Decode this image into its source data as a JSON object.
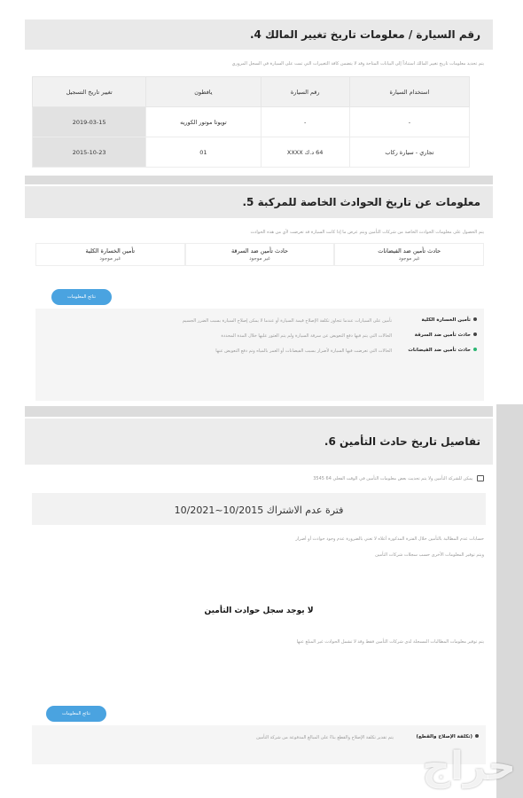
{
  "sections": {
    "s4": {
      "title": "رقم السيارة / معلومات تاريخ تغيير المالك 4.",
      "intro": "يتم تحديد معلومات تاريخ تغيير المالك استناداً إلى البيانات المتاحة وقد لا يتضمن كافة التغييرات التي تمت على السيارة في السجل المروري",
      "table": {
        "headers": [
          "استخدام السيارة",
          "رقم السيارة",
          "يافطون",
          "تغيير تاريخ التسجيل"
        ],
        "rows": [
          [
            "-",
            "-",
            "تويوتا موتور الكوريه",
            "2019-03-15"
          ],
          [
            "تجاري - سيارة ركاب",
            "64 د.ك XXXX",
            "01",
            "2015-10-23"
          ]
        ]
      }
    },
    "s5": {
      "title": "معلومات عن تاريخ الحوادث الخاصة للمركبة 5.",
      "intro": "يتم الحصول على معلومات الحوادث الخاصة من شركات التأمين ويتم عرض ما إذا كانت السيارة قد تعرضت لأي من هذه الحوادث",
      "cards": [
        {
          "label": "حادث تأمين ضد الفيضانات",
          "value": "غير موجود"
        },
        {
          "label": "حادث تأمين ضد السرقة",
          "value": "غير موجود"
        },
        {
          "label": "تأمين الخسارة الكلية",
          "value": "غير موجود"
        }
      ],
      "button": "نتائج المعلومات",
      "legend": [
        {
          "term": "تأمين الخسارة الكلية",
          "desc": "تأمين على السيارات عندما تتجاوز تكلفة الإصلاح قيمة السيارة أو عندما لا يمكن إصلاح السيارة بسبب الضرر الجسيم"
        },
        {
          "term": "حادث تأمين ضد السرقة",
          "desc": "الحالات التي يتم فيها دفع التعويض عن سرقة السيارة ولم يتم العثور عليها خلال المدة المحددة"
        },
        {
          "term": "حادث تأمين ضد الفيضانات",
          "desc": "الحالات التي تعرضت فيها السيارة لأضرار بسبب الفيضانات أو الغمر بالمياه وتم دفع التعويض عنها"
        }
      ]
    },
    "s6": {
      "title": "تفاصيل تاريخ حادث التأمين 6.",
      "note": "يمكن للشركة التأمين ولا يتم تحديث بعض معلومات التأمين في الوقت الفعلي 64 3545",
      "period": "فترة عدم الاشتراك 10/2015~10/2021",
      "para1": "حسابات عدم المطالبة بالتأمين خلال الفترة المذكورة أعلاه لا تعني بالضرورة عدم وجود حوادث أو أضرار",
      "para2": "ويتم توفير المعلومات الأخرى حسب سجلات شركات التأمين",
      "center": "لا يوجد سجل حوادث التأمين",
      "para3": "يتم توفير معلومات المطالبات المسجلة لدى شركات التأمين فقط وقد لا تشمل الحوادث غير المبلغ عنها",
      "button": "نتائج المعلومات",
      "footnote_term": "(تكلفة الإصلاح والقطع)",
      "footnote": "يتم تقدير تكلفة الإصلاح والقطع بناءً على المبالغ المدفوعة من شركة التأمين"
    }
  },
  "watermark": "حراج",
  "colors": {
    "header_bg": "#e9e9e9",
    "accent": "#4aa3e0",
    "alert": "#c0392b"
  }
}
